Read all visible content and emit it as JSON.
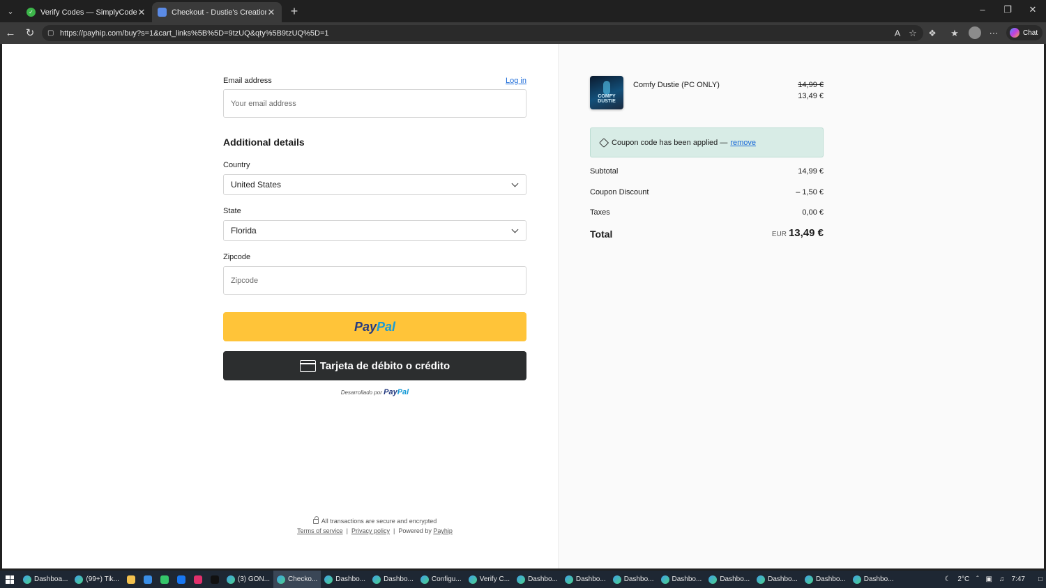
{
  "browser": {
    "tabs": [
      {
        "title": "Verify Codes — SimplyCodes",
        "active": false
      },
      {
        "title": "Checkout - Dustie's Creations",
        "active": true
      }
    ],
    "new_tab_label": "+",
    "url": "https://payhip.com/buy?s=1&cart_links%5B%5D=9tzUQ&qty%5B9tzUQ%5D=1",
    "chat_label": "Chat"
  },
  "checkout": {
    "email_label": "Email address",
    "login_label": "Log in",
    "email_placeholder": "Your email address",
    "additional_title": "Additional details",
    "country_label": "Country",
    "country_value": "United States",
    "state_label": "State",
    "state_value": "Florida",
    "zipcode_label": "Zipcode",
    "zipcode_placeholder": "Zipcode",
    "paypal_pay": "Pay",
    "paypal_pal": "Pal",
    "card_button": "Tarjeta de débito o crédito",
    "powered_by_text": "Desarrollado por",
    "powered_by_brand_pay": "Pay",
    "powered_by_brand_pal": "Pal"
  },
  "footer": {
    "secure_text": "All transactions are secure and encrypted",
    "terms": "Terms of service",
    "privacy": "Privacy policy",
    "powered_prefix": "Powered by",
    "powered_link": "Payhip"
  },
  "order": {
    "product_name": "Comfy Dustie (PC ONLY)",
    "product_image_text": "COMFY DUSTIE",
    "old_price": "14,99 €",
    "new_price": "13,49 €",
    "coupon_text": "Coupon code has been applied —",
    "coupon_remove": "remove",
    "subtotal_label": "Subtotal",
    "subtotal_value": "14,99 €",
    "discount_label": "Coupon Discount",
    "discount_value": "– 1,50 €",
    "taxes_label": "Taxes",
    "taxes_value": "0,00 €",
    "total_label": "Total",
    "total_currency": "EUR",
    "total_value": "13,49 €"
  },
  "taskbar": {
    "items": [
      {
        "label": "Dashboa...",
        "active": false
      },
      {
        "label": "(99+) Tik...",
        "active": false
      },
      {
        "label": "(3) GON...",
        "active": false
      },
      {
        "label": "Checko...",
        "active": true
      },
      {
        "label": "Dashbo...",
        "active": false
      },
      {
        "label": "Dashbo...",
        "active": false
      },
      {
        "label": "Configu...",
        "active": false
      },
      {
        "label": "Verify C...",
        "active": false
      },
      {
        "label": "Dashbo...",
        "active": false
      },
      {
        "label": "Dashbo...",
        "active": false
      },
      {
        "label": "Dashbo...",
        "active": false
      },
      {
        "label": "Dashbo...",
        "active": false
      },
      {
        "label": "Dashbo...",
        "active": false
      },
      {
        "label": "Dashbo...",
        "active": false
      },
      {
        "label": "Dashbo...",
        "active": false
      },
      {
        "label": "Dashbo...",
        "active": false
      }
    ],
    "weather": "2°C",
    "time": "7:47"
  }
}
